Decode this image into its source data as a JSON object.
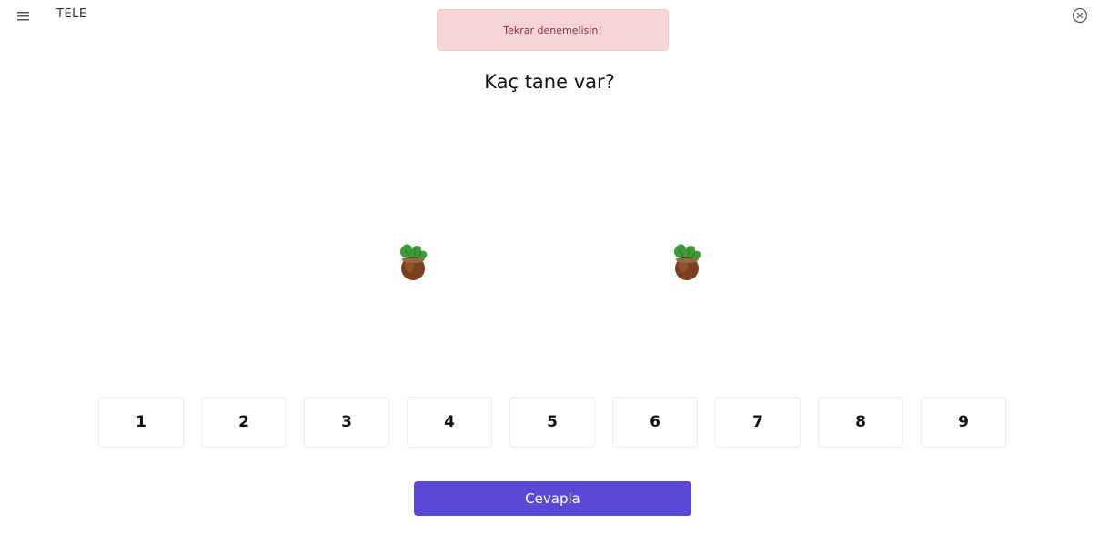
{
  "app": {
    "title": "TELE",
    "menu_icon": "hamburger-menu-icon",
    "close_icon": "close-circle-icon"
  },
  "toast": {
    "message": "Tekrar denemelisin!",
    "background": "#f6d5d9",
    "text_color": "#8a2b3a"
  },
  "question": {
    "text": "Kaç tane var?"
  },
  "items": {
    "icon": "hazelnut-icon",
    "count_shown": 2
  },
  "options": [
    "1",
    "2",
    "3",
    "4",
    "5",
    "6",
    "7",
    "8",
    "9"
  ],
  "submit": {
    "label": "Cevapla",
    "color": "#5a48d6"
  }
}
